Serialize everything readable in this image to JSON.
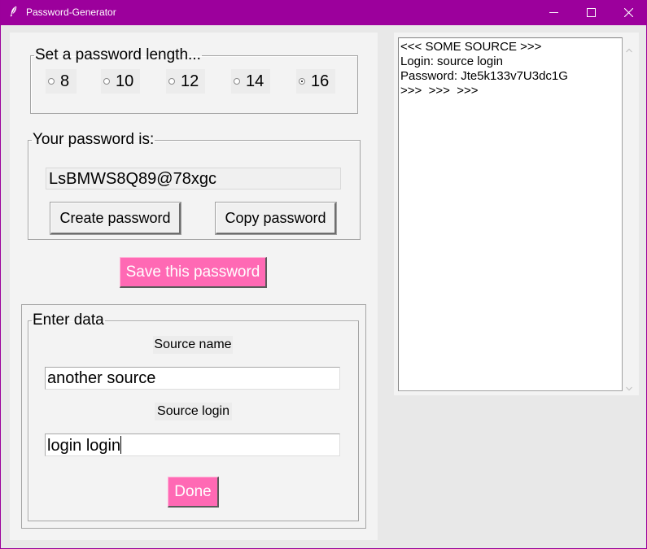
{
  "window": {
    "title": "Password-Generator",
    "icon": "feather-icon",
    "controls": [
      "minimize-icon",
      "maximize-icon",
      "close-icon"
    ]
  },
  "length_group": {
    "legend": "Set a password length...",
    "options": [
      {
        "label": "8",
        "selected": false
      },
      {
        "label": "10",
        "selected": false
      },
      {
        "label": "12",
        "selected": false
      },
      {
        "label": "14",
        "selected": false
      },
      {
        "label": "16",
        "selected": true
      }
    ]
  },
  "password_group": {
    "legend": "Your password is:",
    "value": "LsBMWS8Q89@78xgc",
    "create_label": "Create password",
    "copy_label": "Copy password"
  },
  "save_label": "Save this password",
  "data_group": {
    "legend": "Enter data",
    "source_name_label": "Source name",
    "source_name_value": "another source",
    "source_login_label": "Source login",
    "source_login_value": "login login",
    "done_label": "Done"
  },
  "output": {
    "lines": [
      "<<< SOME SOURCE >>>",
      "Login: source login",
      "Password: Jte5k133v7U3dc1G",
      ">>>  >>>  >>>"
    ]
  },
  "colors": {
    "titlebar": "#9c009c",
    "accent_button": "#ff69b4",
    "panel": "#f3f3f3"
  }
}
